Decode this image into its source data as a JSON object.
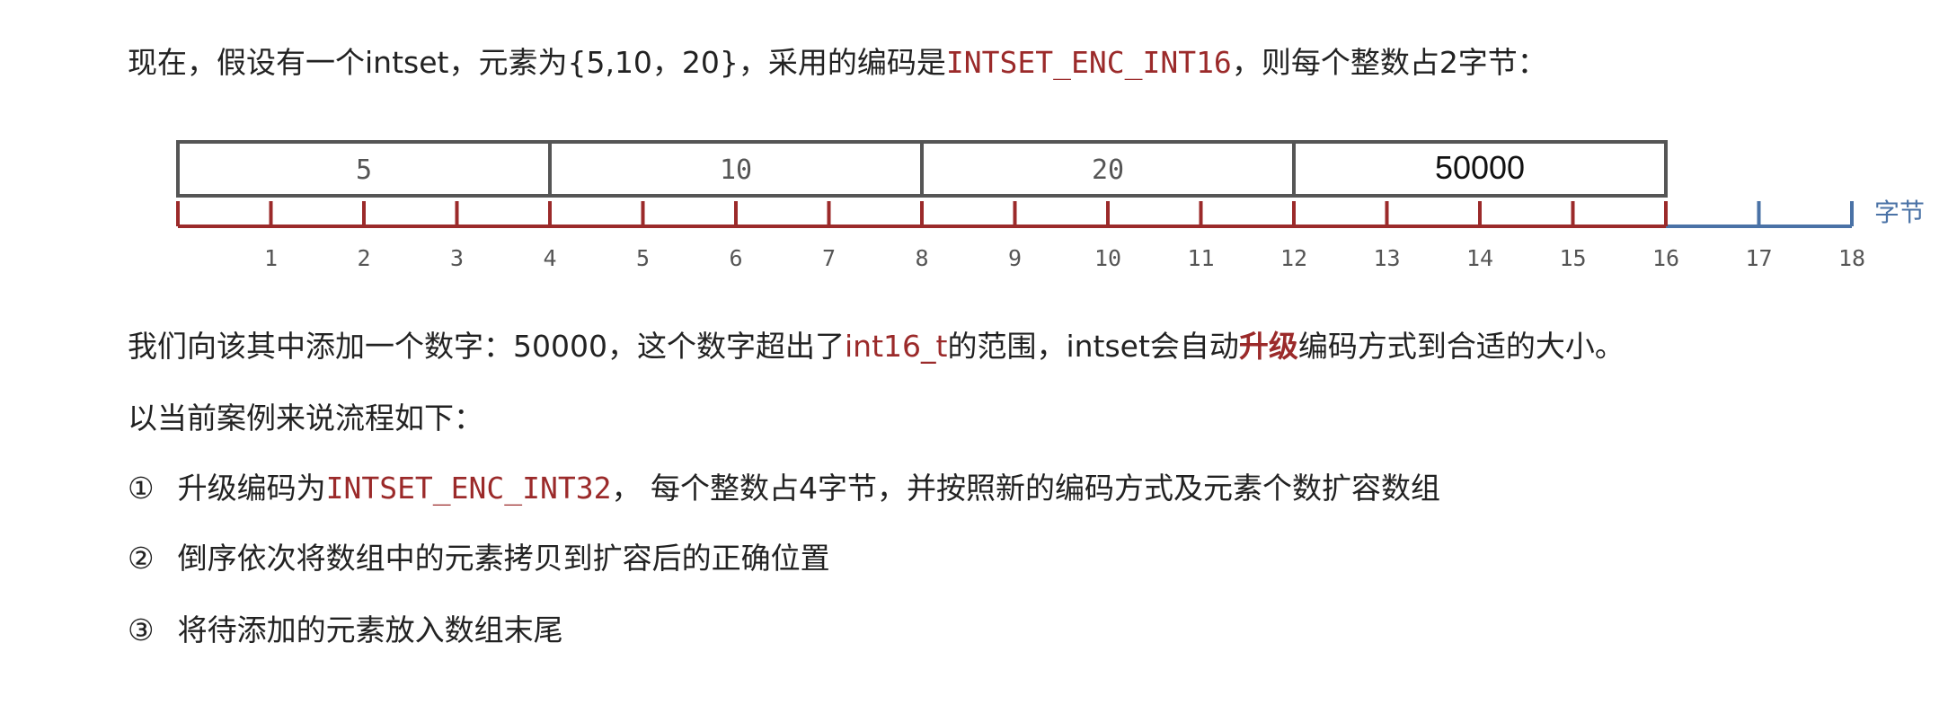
{
  "intro": {
    "part1": "现在，假设有一个intset，元素为{5,10，20}，采用的编码是",
    "encoding": "INTSET_ENC_INT16",
    "part2": "，则每个整数占2字节："
  },
  "diagram": {
    "cells": [
      "5",
      "10",
      "20",
      "50000"
    ],
    "byte_ticks": [
      "1",
      "2",
      "3",
      "4",
      "5",
      "6",
      "7",
      "8",
      "9",
      "10",
      "11",
      "12",
      "13",
      "14",
      "15",
      "16",
      "17",
      "18"
    ],
    "unit_label": "字节",
    "colors": {
      "cell_border": "#555555",
      "used_ruler": "#9b2a2a",
      "extra_ruler": "#4a72a6"
    }
  },
  "para2": {
    "part1": "我们向该其中添加一个数字：50000，这个数字超出了",
    "type_name": "int16_t",
    "part2": "的范围，intset会自动",
    "highlight": "升级",
    "part3": "编码方式到合适的大小。"
  },
  "para3": "以当前案例来说流程如下：",
  "steps": [
    {
      "marker": "①",
      "prefix": "升级编码为",
      "code": "INTSET_ENC_INT32",
      "suffix": "， 每个整数占4字节，并按照新的编码方式及元素个数扩容数组"
    },
    {
      "marker": "②",
      "text": "倒序依次将数组中的元素拷贝到扩容后的正确位置"
    },
    {
      "marker": "③",
      "text": "将待添加的元素放入数组末尾"
    }
  ]
}
